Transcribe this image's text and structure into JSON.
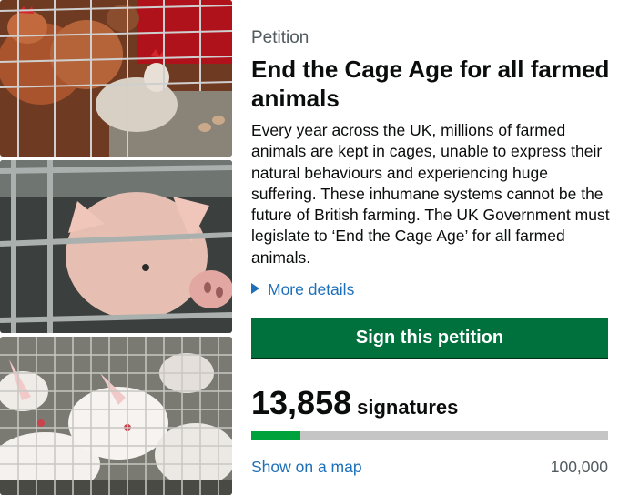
{
  "petition": {
    "caption": "Petition",
    "title": "End the Cage Age for all farmed animals",
    "description": "Every year across the UK, millions of farmed animals are kept in cages, unable to express their natural behaviours and experiencing huge suffering. These inhumane systems cannot be the future of British farming. The UK Government must legislate to ‘End the Cage Age’ for all farmed animals.",
    "more_details": "More details",
    "sign_label": "Sign this petition",
    "signature_count": "13,858",
    "signature_label": "signatures",
    "map_link": "Show on a map",
    "target": "100,000",
    "progress_fraction": 0.1386
  },
  "photos": [
    "caged-hens-photo",
    "caged-pig-photo",
    "caged-rabbits-photo"
  ],
  "colors": {
    "accent": "#00703c",
    "link": "#1d70b8",
    "progress": "#00a33b",
    "track": "#c5c5c5"
  }
}
